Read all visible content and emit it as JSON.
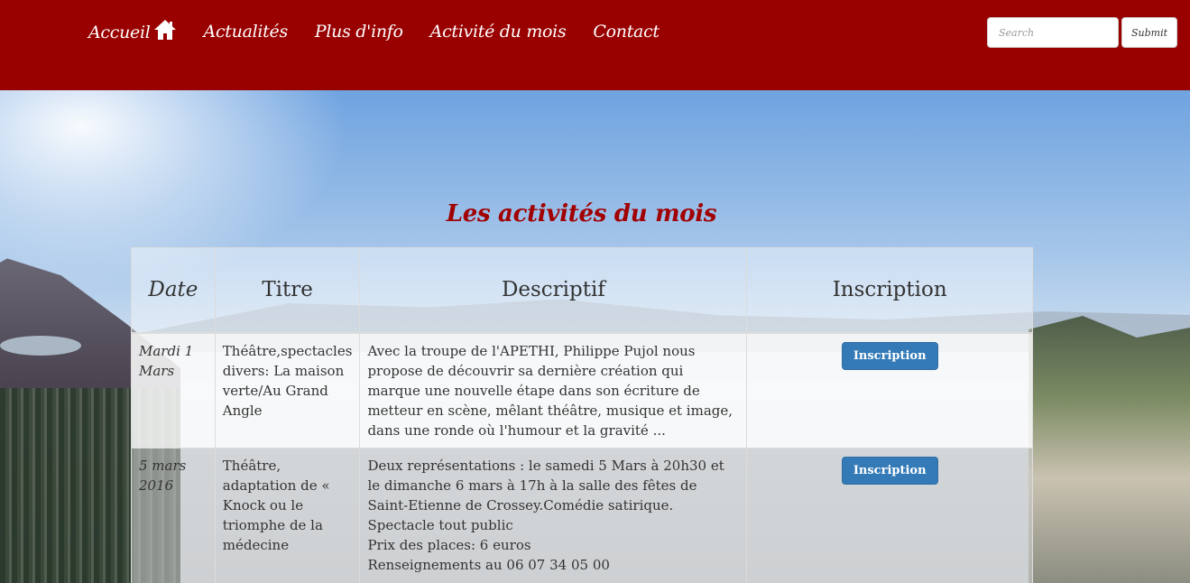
{
  "nav": {
    "items": [
      {
        "label": "Accueil",
        "icon": "home-icon"
      },
      {
        "label": "Actualités"
      },
      {
        "label": "Plus d'info"
      },
      {
        "label": "Activité du mois"
      },
      {
        "label": "Contact"
      }
    ],
    "search_placeholder": "Search",
    "submit_label": "Submit"
  },
  "colors": {
    "navbar": "#990000",
    "title": "#a10000",
    "button": "#337ab7"
  },
  "main": {
    "title": "Les activités du mois",
    "headers": [
      "Date",
      "Titre",
      "Descriptif",
      "Inscription"
    ],
    "rows": [
      {
        "date": "Mardi 1 Mars",
        "title": "Théâtre,spectacles divers: La maison verte/Au Grand Angle",
        "description": [
          "Avec la troupe de l'APETHI, Philippe Pujol nous propose de découvrir sa dernière création qui marque une nouvelle étape dans son écriture de metteur en scène, mêlant théâtre, musique et image, dans une ronde où l'humour et la gravité ..."
        ],
        "button": "Inscription"
      },
      {
        "date": "5 mars 2016",
        "title": "Théâtre, adaptation de « Knock ou le triomphe de la médecine",
        "description": [
          "Deux représentations : le samedi 5 Mars à 20h30 et le dimanche 6 mars à 17h à la salle des fêtes de Saint-Etienne de Crossey.Comédie satirique. Spectacle tout public",
          "Prix des places: 6 euros",
          "Renseignements au 06 07 34 05 00"
        ],
        "button": "Inscription"
      }
    ]
  }
}
